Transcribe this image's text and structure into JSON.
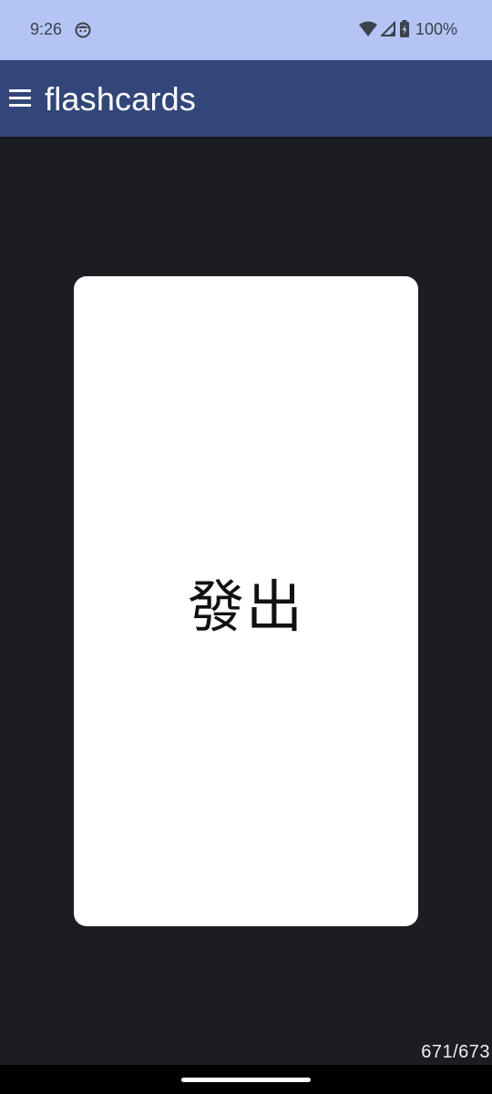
{
  "status_bar": {
    "time": "9:26",
    "battery_percent": "100%",
    "icons": [
      "face-icon",
      "wifi-icon",
      "signal-icon",
      "battery-charging-icon"
    ],
    "background": "#b4c5f5"
  },
  "app_bar": {
    "title": "flashcards",
    "menu_icon": "hamburger-menu-icon",
    "background": "#33467a"
  },
  "card": {
    "front_text": "發出",
    "background": "#ffffff"
  },
  "counter": {
    "text": "671/673",
    "current": 671,
    "total": 673
  },
  "colors": {
    "page_background": "#1c1d22",
    "nav_bar": "#000000"
  }
}
